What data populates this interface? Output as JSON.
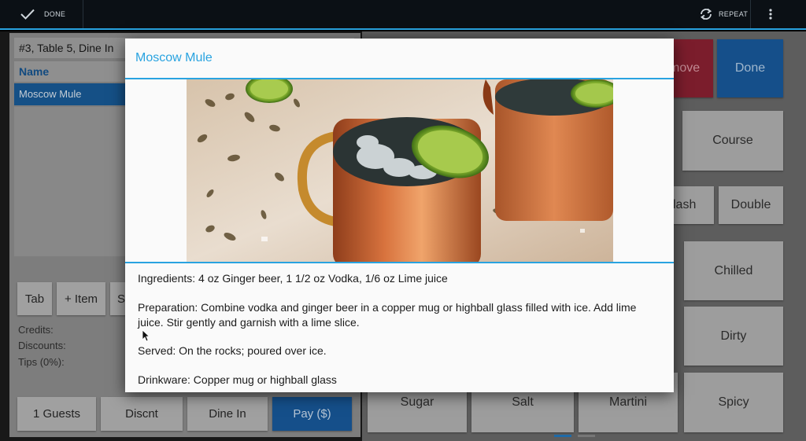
{
  "topbar": {
    "done_label": "DONE",
    "repeat_label": "REPEAT",
    "accent": "#29a3e0"
  },
  "order": {
    "header": "#3, Table 5, Dine In",
    "column_name": "Name",
    "items": [
      "Moscow Mule"
    ]
  },
  "left_buttons": {
    "tab": "Tab",
    "add_item": "+ Item",
    "partial": "S"
  },
  "totals": {
    "credits": "Credits:",
    "discounts": "Discounts:",
    "tips": "Tips (0%):"
  },
  "bottom_buttons": {
    "guests": "1 Guests",
    "discount": "Discnt",
    "dine_in": "Dine In",
    "pay": "Pay ($)"
  },
  "right_panel": {
    "remove_partial": "move",
    "done": "Done",
    "modifiers": [
      "Course",
      "lash",
      "Double",
      "Chilled",
      "Dirty",
      "Sugar",
      "Salt",
      "Martini",
      "Spicy"
    ]
  },
  "modal": {
    "title": "Moscow Mule",
    "ingredients": "Ingredients: 4 oz Ginger beer, 1 1/2 oz Vodka, 1/6 oz Lime juice",
    "preparation": "Preparation: Combine vodka and ginger beer in a copper mug or highball glass filled with ice. Add lime juice. Stir gently and garnish with a lime slice.",
    "served": "Served: On the rocks; poured over ice.",
    "drinkware": "Drinkware: Copper mug or highball glass"
  },
  "icons": [
    "check-icon",
    "repeat-icon",
    "overflow-menu-icon",
    "mouse-cursor-icon"
  ],
  "colors": {
    "accent": "#29a3e0",
    "selection": "#155086",
    "remove": "#c62840",
    "primary_button": "#1565c0"
  }
}
